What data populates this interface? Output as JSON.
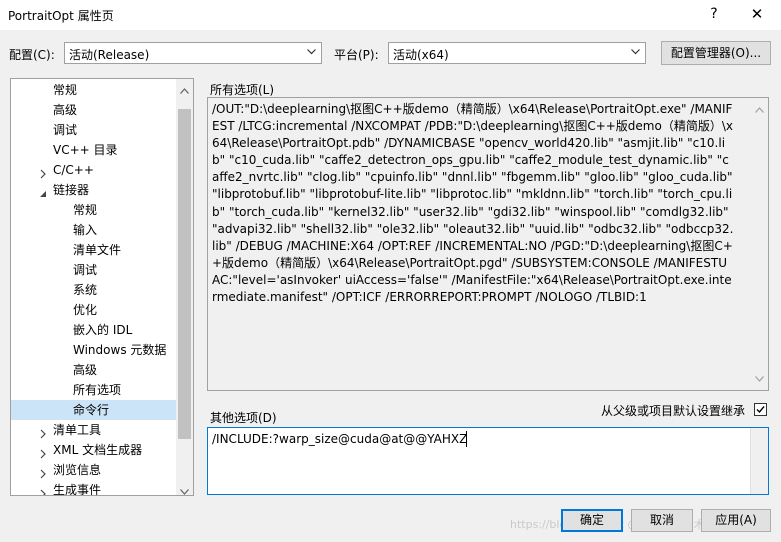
{
  "window": {
    "title": "PortraitOpt 属性页",
    "help_label": "?",
    "close_label": "✕"
  },
  "config": {
    "config_label": "配置(C):",
    "config_value": "活动(Release)",
    "platform_label": "平台(P):",
    "platform_value": "活动(x64)",
    "manager_button": "配置管理器(O)..."
  },
  "tree": {
    "items": [
      {
        "label": "常规",
        "expander": ""
      },
      {
        "label": "高级",
        "expander": ""
      },
      {
        "label": "调试",
        "expander": ""
      },
      {
        "label": "VC++ 目录",
        "expander": ""
      },
      {
        "label": "C/C++",
        "expander": "collapsed"
      },
      {
        "label": "链接器",
        "expander": "expanded"
      },
      {
        "label": "常规",
        "expander": ""
      },
      {
        "label": "输入",
        "expander": ""
      },
      {
        "label": "清单文件",
        "expander": ""
      },
      {
        "label": "调试",
        "expander": ""
      },
      {
        "label": "系统",
        "expander": ""
      },
      {
        "label": "优化",
        "expander": ""
      },
      {
        "label": "嵌入的 IDL",
        "expander": ""
      },
      {
        "label": "Windows 元数据",
        "expander": ""
      },
      {
        "label": "高级",
        "expander": ""
      },
      {
        "label": "所有选项",
        "expander": ""
      },
      {
        "label": "命令行",
        "expander": "",
        "selected": true
      },
      {
        "label": "清单工具",
        "expander": "collapsed"
      },
      {
        "label": "XML 文档生成器",
        "expander": "collapsed"
      },
      {
        "label": "浏览信息",
        "expander": "collapsed"
      },
      {
        "label": "生成事件",
        "expander": "collapsed"
      }
    ]
  },
  "main": {
    "all_options_label": "所有选项(L)",
    "all_options_text": "/OUT:\"D:\\deeplearning\\抠图C++版demo（精简版）\\x64\\Release\\PortraitOpt.exe\" /MANIFEST /LTCG:incremental /NXCOMPAT /PDB:\"D:\\deeplearning\\抠图C++版demo（精简版）\\x64\\Release\\PortraitOpt.pdb\" /DYNAMICBASE \"opencv_world420.lib\" \"asmjit.lib\" \"c10.lib\" \"c10_cuda.lib\" \"caffe2_detectron_ops_gpu.lib\" \"caffe2_module_test_dynamic.lib\" \"caffe2_nvrtc.lib\" \"clog.lib\" \"cpuinfo.lib\" \"dnnl.lib\" \"fbgemm.lib\" \"gloo.lib\" \"gloo_cuda.lib\" \"libprotobuf.lib\" \"libprotobuf-lite.lib\" \"libprotoc.lib\" \"mkldnn.lib\" \"torch.lib\" \"torch_cpu.lib\" \"torch_cuda.lib\" \"kernel32.lib\" \"user32.lib\" \"gdi32.lib\" \"winspool.lib\" \"comdlg32.lib\" \"advapi32.lib\" \"shell32.lib\" \"ole32.lib\" \"oleaut32.lib\" \"uuid.lib\" \"odbc32.lib\" \"odbccp32.lib\" /DEBUG /MACHINE:X64 /OPT:REF /INCREMENTAL:NO /PGD:\"D:\\deeplearning\\抠图C++版demo（精简版）\\x64\\Release\\PortraitOpt.pgd\" /SUBSYSTEM:CONSOLE /MANIFESTUAC:\"level='asInvoker' uiAccess='false'\" /ManifestFile:\"x64\\Release\\PortraitOpt.exe.intermediate.manifest\" /OPT:ICF /ERRORREPORT:PROMPT /NOLOGO /TLBID:1",
    "other_options_label": "其他选项(D)",
    "inherit_label": "从父级或项目默认设置继承",
    "inherit_checked": true,
    "other_options_value": "/INCLUDE:?warp_size@cuda@at@@YAHXZ"
  },
  "footer": {
    "ok_label": "确定",
    "cancel_label": "取消",
    "apply_label": "应用(A)",
    "watermark": "https://blog.csdn.net @稀土掘金技术社区"
  }
}
